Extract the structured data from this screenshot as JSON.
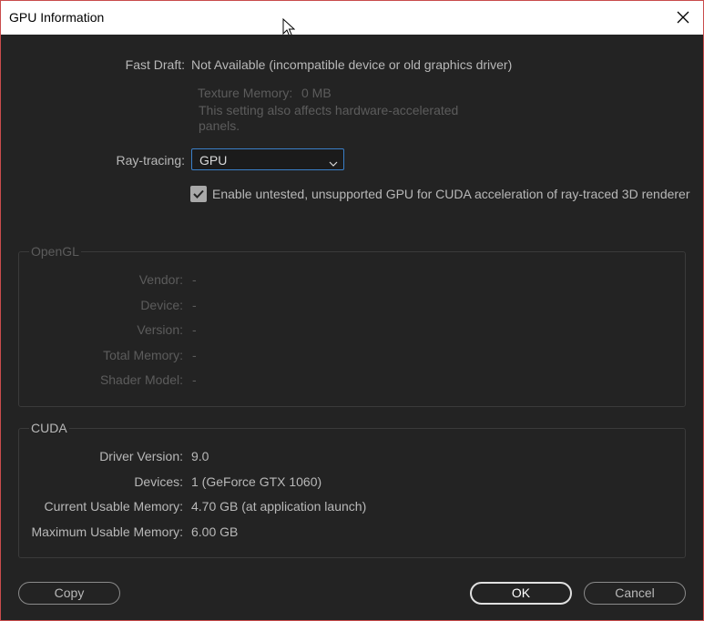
{
  "window": {
    "title": "GPU Information"
  },
  "fast_draft": {
    "label": "Fast Draft:",
    "value": "Not Available (incompatible device or old graphics driver)",
    "texture_memory_label": "Texture Memory:",
    "texture_memory_value": "0 MB",
    "note_line1": "This setting also affects hardware-accelerated",
    "note_line2": "panels."
  },
  "ray_tracing": {
    "label": "Ray-tracing:",
    "selected": "GPU"
  },
  "cuda_checkbox": {
    "checked": true,
    "label": "Enable untested, unsupported GPU for CUDA acceleration of ray-traced 3D renderer"
  },
  "opengl": {
    "title": "OpenGL",
    "rows": [
      {
        "label": "Vendor:",
        "value": "-"
      },
      {
        "label": "Device:",
        "value": "-"
      },
      {
        "label": "Version:",
        "value": "-"
      },
      {
        "label": "Total Memory:",
        "value": "-"
      },
      {
        "label": "Shader Model:",
        "value": "-"
      }
    ]
  },
  "cuda": {
    "title": "CUDA",
    "rows": [
      {
        "label": "Driver Version:",
        "value": "9.0"
      },
      {
        "label": "Devices:",
        "value": "1 (GeForce GTX 1060)"
      },
      {
        "label": "Current Usable Memory:",
        "value": "4.70 GB (at application launch)"
      },
      {
        "label": "Maximum Usable Memory:",
        "value": "6.00 GB"
      }
    ]
  },
  "buttons": {
    "copy": "Copy",
    "ok": "OK",
    "cancel": "Cancel"
  },
  "colors": {
    "dialog_background": "#232323",
    "text": "#b8b8b8",
    "disabled_text": "#5c5c5c",
    "focus_border": "#3a7fc8",
    "window_border": "#c94c4c"
  }
}
